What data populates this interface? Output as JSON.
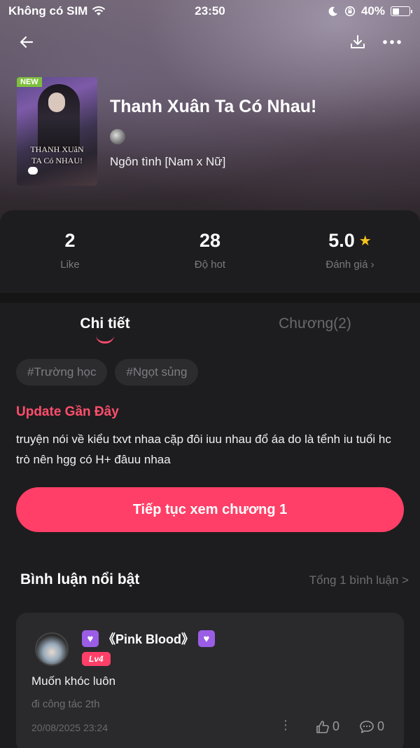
{
  "status_bar": {
    "carrier": "Không có SIM",
    "time": "23:50",
    "battery_percent": "40%",
    "battery_level": 0.4
  },
  "header": {
    "back_icon": "arrow-left-icon",
    "download_icon": "download-icon",
    "more_icon": "more-horizontal-icon"
  },
  "book": {
    "badge": "NEW",
    "cover_title_line1": "THANH XUâN",
    "cover_title_line2": "TA Có NHAU!",
    "title": "Thanh Xuân Ta Có Nhau!",
    "genre": "Ngôn tình [Nam x Nữ]"
  },
  "stats": [
    {
      "value": "2",
      "label": "Like"
    },
    {
      "value": "28",
      "label": "Độ hot"
    },
    {
      "value": "5.0",
      "label": "Đánh giá ›",
      "has_star": true
    }
  ],
  "tabs": [
    {
      "label": "Chi tiết",
      "active": true
    },
    {
      "label": "Chương(2)",
      "active": false
    }
  ],
  "tags": [
    "#Trường học",
    "#Ngọt sủng"
  ],
  "update": {
    "title": "Update Gần Đây",
    "body": "truyện nói về kiểu txvt nhaa cặp đôi iuu nhau đổ áa do là tểnh iu tuổi hc trò nên hgg có H+ đâuu nhaa"
  },
  "cta_label": "Tiếp tục xem chương 1",
  "comments": {
    "title": "Bình luận nổi bật",
    "total": "Tổng 1 bình luận >",
    "items": [
      {
        "user": "《Pink Blood》",
        "level": "Lv4",
        "text": "Muốn khóc luôn",
        "sub": "đi công tác 2th",
        "date": "20/08/2025 23:24",
        "likes": "0",
        "replies": "0"
      }
    ]
  },
  "colors": {
    "accent": "#ff3f67",
    "update_title": "#ff4e6c",
    "star": "#f7c21c",
    "panel": "#1d1d1f"
  }
}
